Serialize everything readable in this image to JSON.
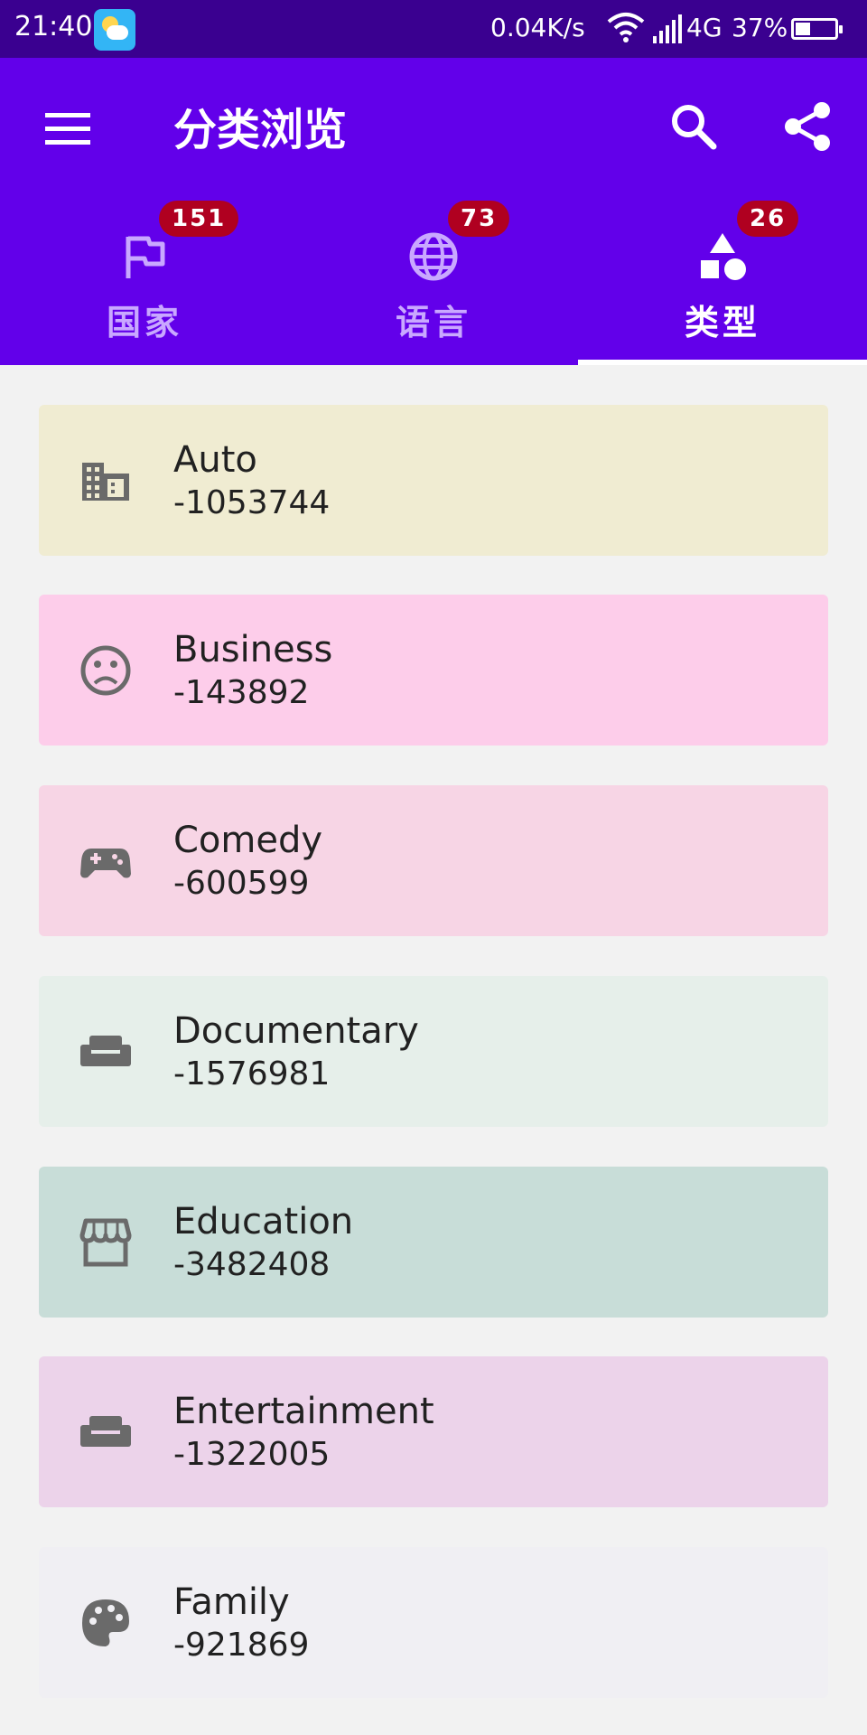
{
  "status_bar": {
    "time": "21:40",
    "net_speed": "0.04K/s",
    "network_type": "4G",
    "battery_percent": "37%",
    "battery_level": 0.37
  },
  "app_bar": {
    "title": "分类浏览",
    "menu_icon": "menu-icon",
    "search_icon": "search-icon",
    "share_icon": "share-icon",
    "color": "#6200ea"
  },
  "tabs": [
    {
      "label": "国家",
      "badge": "151",
      "icon": "flag-icon",
      "active": false
    },
    {
      "label": "语言",
      "badge": "73",
      "icon": "globe-icon",
      "active": false
    },
    {
      "label": "类型",
      "badge": "26",
      "icon": "shapes-icon",
      "active": true
    }
  ],
  "categories": [
    {
      "name": "Auto",
      "value": "-1053744",
      "icon": "building-icon",
      "color": "#f0ecd2"
    },
    {
      "name": "Business",
      "value": "-143892",
      "icon": "sad-face-icon",
      "color": "#fdcdea"
    },
    {
      "name": "Comedy",
      "value": "-600599",
      "icon": "gamepad-icon",
      "color": "#f7d5e5"
    },
    {
      "name": "Documentary",
      "value": "-1576981",
      "icon": "sofa-icon",
      "color": "#e6efea"
    },
    {
      "name": "Education",
      "value": "-3482408",
      "icon": "store-icon",
      "color": "#c8ddd8"
    },
    {
      "name": "Entertainment",
      "value": "-1322005",
      "icon": "sofa-icon",
      "color": "#ecd3ea"
    },
    {
      "name": "Family",
      "value": "-921869",
      "icon": "palette-icon",
      "color": "#f0eff3"
    }
  ]
}
